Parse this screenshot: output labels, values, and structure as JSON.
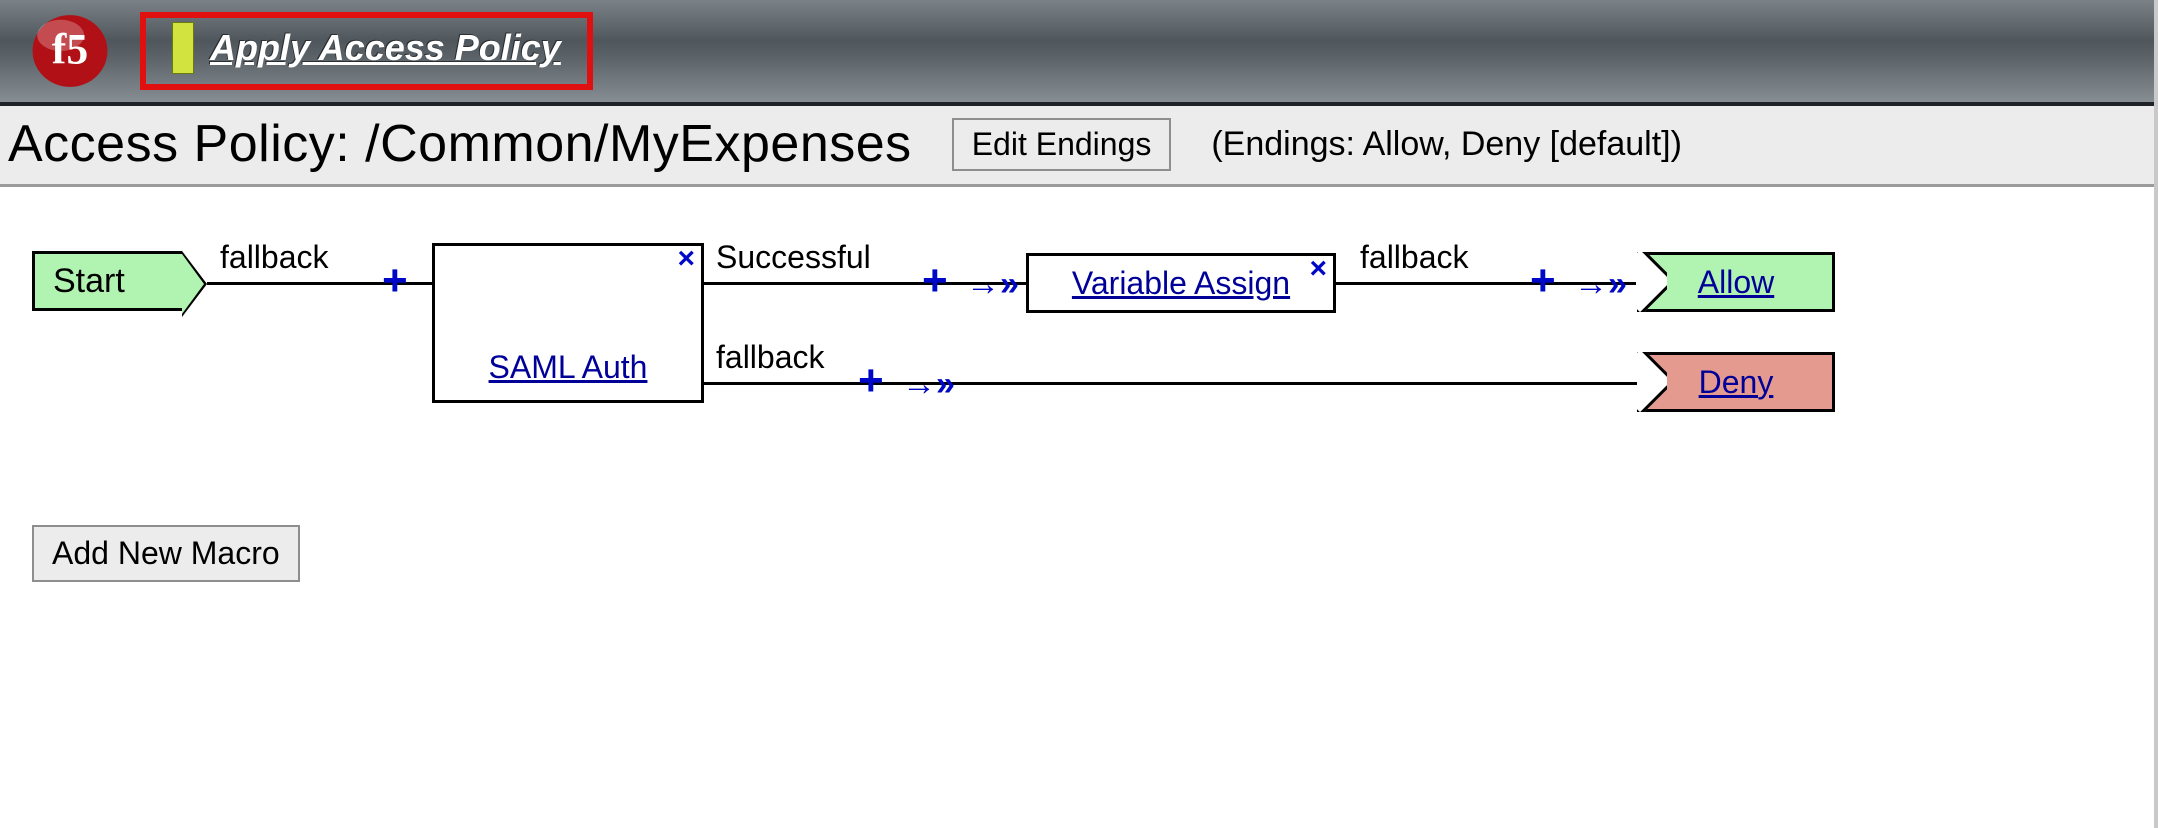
{
  "header": {
    "apply_label": "Apply Access Policy"
  },
  "titlebar": {
    "title": "Access Policy: /Common/MyExpenses",
    "edit_endings_label": "Edit Endings",
    "endings_summary": "(Endings: Allow, Deny [default])"
  },
  "flow": {
    "start_label": "Start",
    "edge_start": "fallback",
    "node_saml": "SAML Auth",
    "edge_saml_success": "Successful",
    "edge_saml_fallback": "fallback",
    "node_var_assign": "Variable Assign",
    "edge_var_fallback": "fallback",
    "ending_allow": "Allow",
    "ending_deny": "Deny"
  },
  "footer": {
    "add_macro_label": "Add New Macro"
  },
  "highlight": "apply-access-policy"
}
